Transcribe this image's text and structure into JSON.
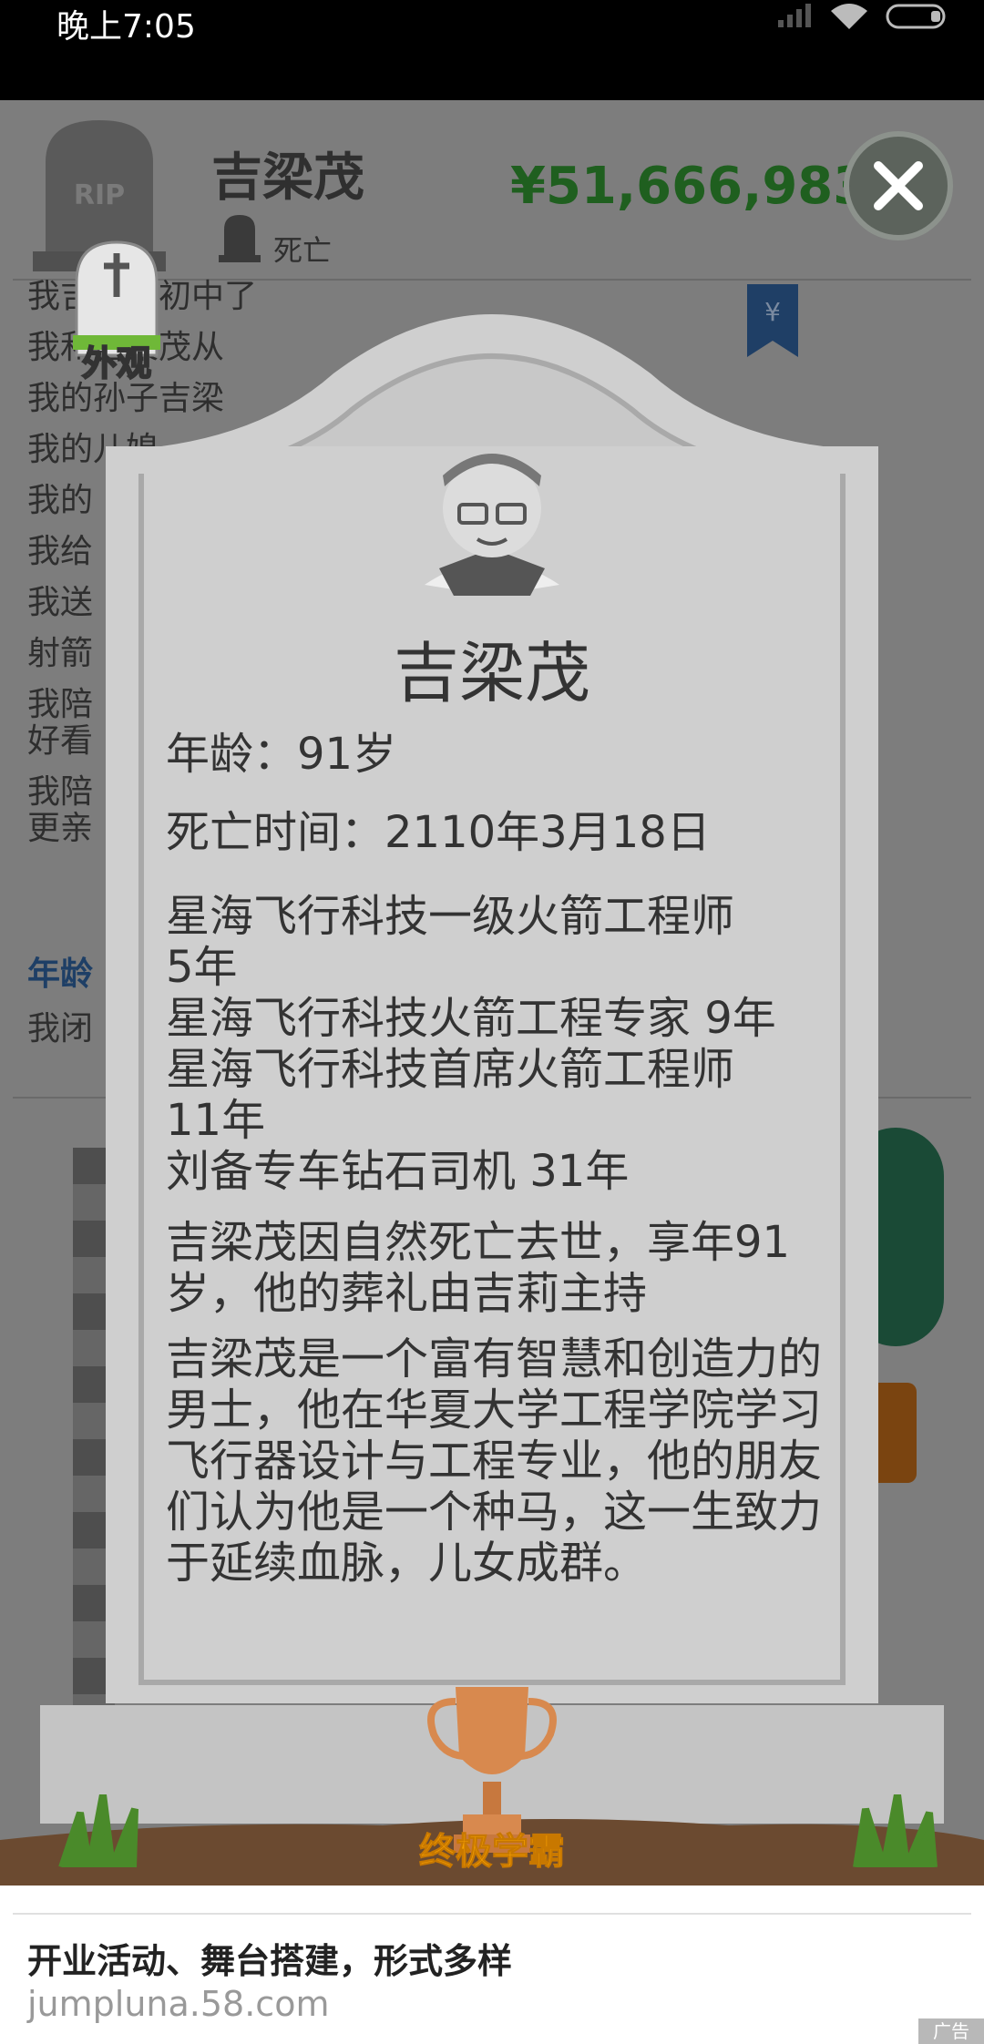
{
  "status_bar": {
    "time": "晚上7:05"
  },
  "background": {
    "name": "吉梁茂",
    "status": "死亡",
    "money": "¥51,666,983",
    "log_lines": [
      "我吉茂上初中了",
      "我和吉梁茂从",
      "我的孙子吉梁",
      "我的儿媳",
      "我的",
      "我给",
      "我送",
      "射箭",
      "我陪",
      "好看",
      "我陪",
      "更亲"
    ],
    "age_header": "年龄",
    "age_text": "我闭"
  },
  "appearance": {
    "label": "外观"
  },
  "tombstone": {
    "name": "吉梁茂",
    "age": "年龄：91岁",
    "death_time": "死亡时间：2110年3月18日",
    "careers": [
      "星海飞行科技一级火箭工程师",
      "5年",
      "星海飞行科技火箭工程专家 9年",
      "星海飞行科技首席火箭工程师",
      "11年",
      "刘备专车钻石司机 31年"
    ],
    "cause": "吉梁茂因自然死亡去世，享年91岁，他的葬礼由吉莉主持",
    "bio": "吉梁茂是一个富有智慧和创造力的男士，他在华夏大学工程学院学习飞行器设计与工程专业，他的朋友们认为他是一个种马，这一生致力于延续血脉，儿女成群。",
    "achievement": "终极学霸"
  },
  "ad": {
    "title": "开业活动、舞台搭建，形式多样",
    "url": "jumpluna.58.com",
    "tag": "广告"
  }
}
